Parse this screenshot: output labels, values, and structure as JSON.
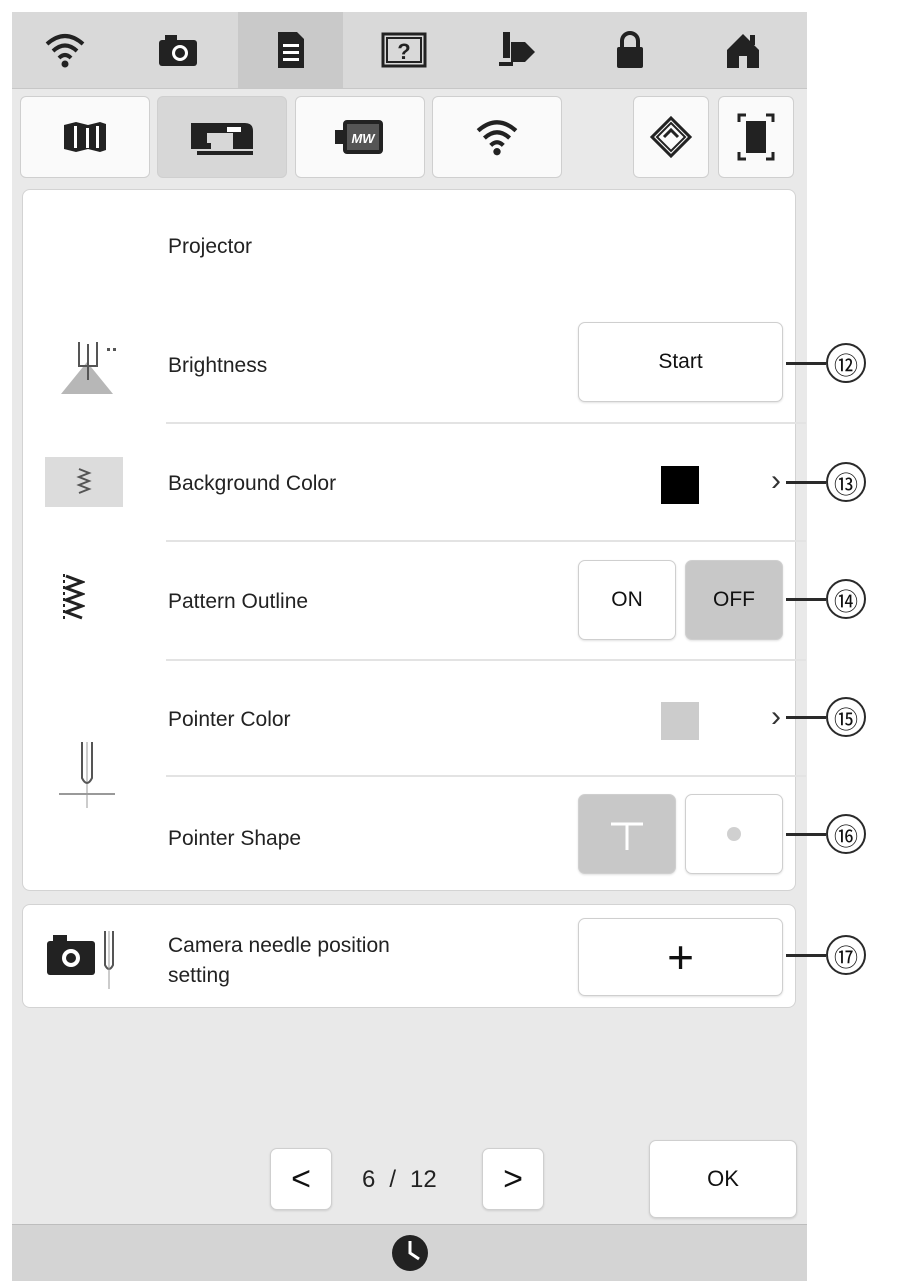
{
  "top_bar": {
    "icons": [
      "wifi-icon",
      "camera-icon",
      "document-icon",
      "help-icon",
      "presser-foot-icon",
      "lock-icon",
      "home-icon"
    ]
  },
  "tabs": {
    "icons": [
      "map-icon",
      "sewing-machine-icon",
      "embroidery-icon",
      "wifi-icon",
      "eraser-icon",
      "fullscreen-icon"
    ]
  },
  "projector": {
    "section_title": "Projector",
    "brightness": {
      "label": "Brightness",
      "button": "Start"
    },
    "background_color": {
      "label": "Background Color",
      "value_color": "#000000"
    },
    "pattern_outline": {
      "label": "Pattern Outline",
      "on": "ON",
      "off": "OFF",
      "selected": "OFF"
    },
    "pointer_color": {
      "label": "Pointer Color",
      "value_color": "#cccccc"
    },
    "pointer_shape": {
      "label": "Pointer Shape",
      "selected": "T-shape"
    }
  },
  "camera": {
    "label_line1": "Camera needle position",
    "label_line2": "setting",
    "button_symbol": "+"
  },
  "pagination": {
    "current": "6",
    "separator": "/",
    "total": "12",
    "prev": "<",
    "next": ">"
  },
  "ok_button": "OK",
  "callouts": [
    "⑫",
    "⑬",
    "⑭",
    "⑮",
    "⑯",
    "⑰"
  ]
}
